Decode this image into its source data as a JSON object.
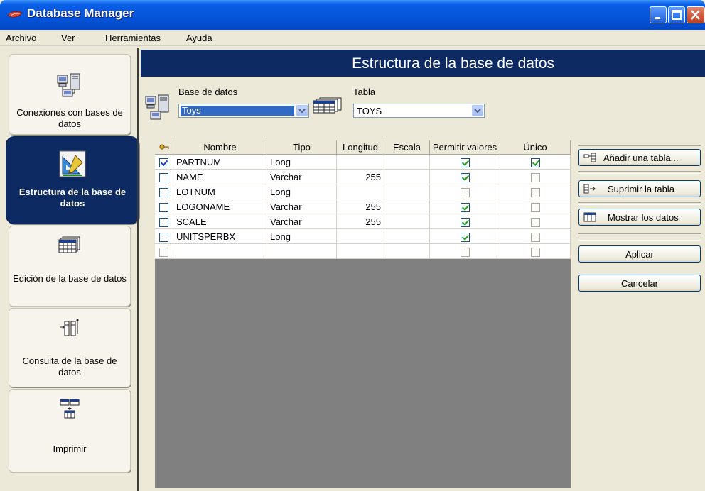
{
  "window": {
    "title": "Database Manager"
  },
  "menu": [
    {
      "label": "Archivo"
    },
    {
      "label": "Ver"
    },
    {
      "label": "Herramientas"
    },
    {
      "label": "Ayuda"
    }
  ],
  "nav": [
    {
      "label": "Conexiones con bases de datos",
      "icon": "computers-icon",
      "active": false
    },
    {
      "label": "Estructura de la base de datos",
      "icon": "structure-icon",
      "active": true
    },
    {
      "label": "Edición de la base de datos",
      "icon": "table-icon",
      "active": false
    },
    {
      "label": "Consulta de la base de datos",
      "icon": "query-icon",
      "active": false
    },
    {
      "label": "Imprimir",
      "icon": "print-icon",
      "active": false
    }
  ],
  "main": {
    "header": "Estructura de la base de datos",
    "database_label": "Base de datos",
    "database_value": "Toys",
    "table_label": "Tabla",
    "table_value": "TOYS"
  },
  "grid": {
    "columns": [
      "",
      "Nombre",
      "Tipo",
      "Longitud",
      "Escala",
      "Permitir valores",
      "Único"
    ],
    "rows": [
      {
        "key": true,
        "name": "PARTNUM",
        "type": "Long",
        "length": "",
        "scale": "",
        "allow_null": true,
        "unique": true
      },
      {
        "key": false,
        "name": "NAME",
        "type": "Varchar",
        "length": "255",
        "scale": "",
        "allow_null": true,
        "unique": false
      },
      {
        "key": false,
        "name": "LOTNUM",
        "type": "Long",
        "length": "",
        "scale": "",
        "allow_null": false,
        "unique": false
      },
      {
        "key": false,
        "name": "LOGONAME",
        "type": "Varchar",
        "length": "255",
        "scale": "",
        "allow_null": true,
        "unique": false
      },
      {
        "key": false,
        "name": "SCALE",
        "type": "Varchar",
        "length": "255",
        "scale": "",
        "allow_null": true,
        "unique": false
      },
      {
        "key": false,
        "name": "UNITSPERBX",
        "type": "Long",
        "length": "",
        "scale": "",
        "allow_null": true,
        "unique": false
      },
      {
        "key": false,
        "name": "",
        "type": "",
        "length": "",
        "scale": "",
        "allow_null": false,
        "unique": false
      }
    ]
  },
  "actions": {
    "add_table": "Añadir una tabla...",
    "delete_table": "Suprimir la tabla",
    "show_data": "Mostrar los datos",
    "apply": "Aplicar",
    "cancel": "Cancelar"
  }
}
